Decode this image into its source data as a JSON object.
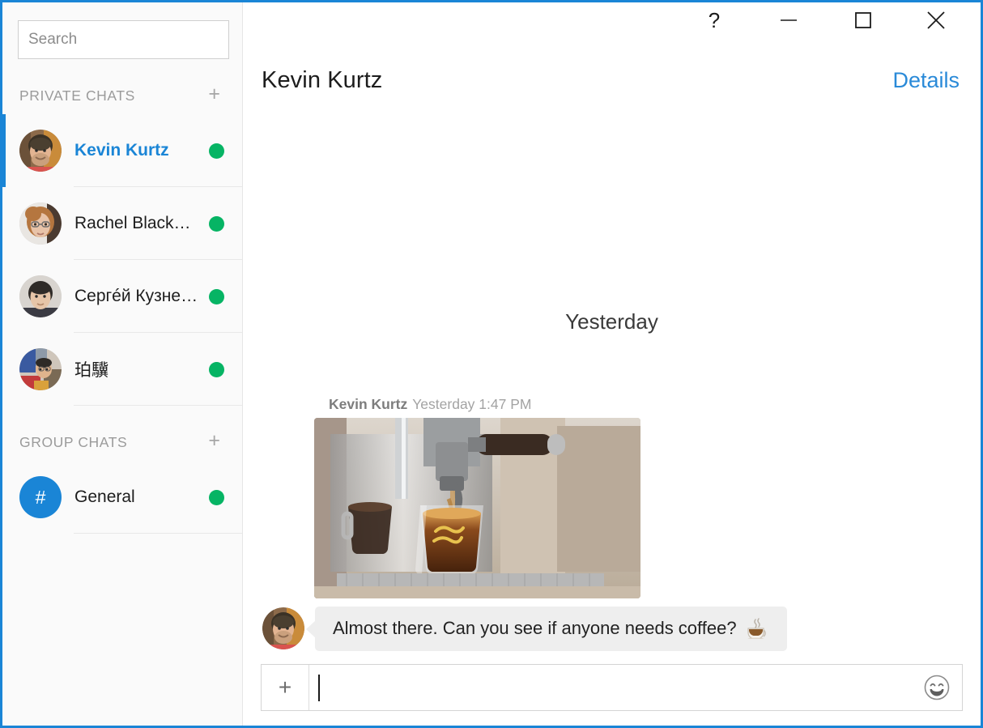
{
  "window": {
    "accent_color": "#1a85d6",
    "controls": [
      {
        "name": "help",
        "label": "?",
        "icon": "question-mark-icon"
      },
      {
        "name": "minimize",
        "label": "—",
        "icon": "minimize-icon"
      },
      {
        "name": "maximize",
        "label": "▢",
        "icon": "maximize-icon"
      },
      {
        "name": "close",
        "label": "✕",
        "icon": "close-icon"
      }
    ]
  },
  "sidebar": {
    "search": {
      "value": "",
      "placeholder": "Search",
      "icon": "search-icon"
    },
    "sections": [
      {
        "title": "PRIVATE CHATS",
        "add_label": "+",
        "items": [
          {
            "name": "Kevin Kurtz",
            "status": "online",
            "selected": true,
            "avatar": "photo-man-beard"
          },
          {
            "name": "Rachel Black…",
            "status": "online",
            "selected": false,
            "avatar": "photo-woman-glasses"
          },
          {
            "name": "Сергéй Кузне…",
            "status": "online",
            "selected": false,
            "avatar": "photo-man-dark-hair"
          },
          {
            "name": "珀驥",
            "status": "online",
            "selected": false,
            "avatar": "photo-person-colorful"
          }
        ]
      },
      {
        "title": "GROUP CHATS",
        "add_label": "+",
        "items": [
          {
            "name": "General",
            "status": "online",
            "selected": false,
            "avatar": "hash",
            "avatar_glyph": "#"
          }
        ]
      }
    ],
    "presence_color": "#06b464"
  },
  "header": {
    "title": "Kevin Kurtz",
    "details_label": "Details"
  },
  "conversation": {
    "day_divider": "Yesterday",
    "messages": [
      {
        "author": "Kevin Kurtz",
        "timestamp": "Yesterday 1:47 PM",
        "attachment": "espresso-machine-photo",
        "text": "Almost there.  Can you see if anyone needs coffee?",
        "emoji": "hot-beverage"
      }
    ]
  },
  "composer": {
    "add_label": "+",
    "input_value": "",
    "input_placeholder": "",
    "emoji_icon": "smiley-face-icon"
  }
}
